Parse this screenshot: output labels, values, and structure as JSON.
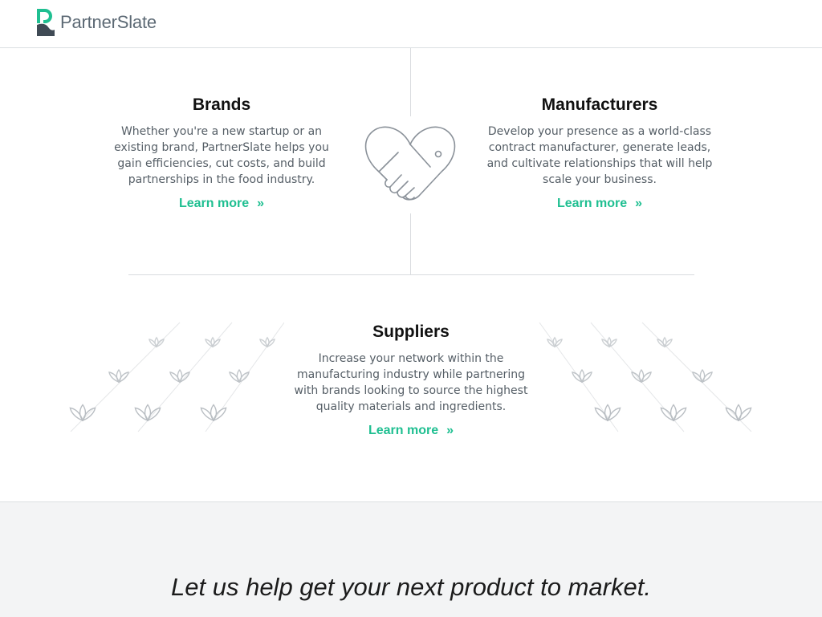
{
  "header": {
    "logo_text": "PartnerSlate",
    "brand_color": "#1fbf91"
  },
  "brands": {
    "title": "Brands",
    "description": "Whether you're a new startup or an existing brand, PartnerSlate helps you gain efficiencies, cut costs, and build partnerships in the food industry.",
    "link_label": "Learn more",
    "link_arrow": "»"
  },
  "manufacturers": {
    "title": "Manufacturers",
    "description": "Develop your presence as a world-class contract manufacturer, generate leads, and cultivate relationships that will help scale your business.",
    "link_label": "Learn more",
    "link_arrow": "»"
  },
  "suppliers": {
    "title": "Suppliers",
    "description": "Increase your network within the manufacturing industry while partnering with brands looking to source the highest quality materials and ingredients.",
    "link_label": "Learn more",
    "link_arrow": "»"
  },
  "icons": {
    "center": "handshake-heart-icon",
    "decor": "sprout-icon"
  },
  "cta": {
    "headline": "Let us help get your next product to market."
  }
}
